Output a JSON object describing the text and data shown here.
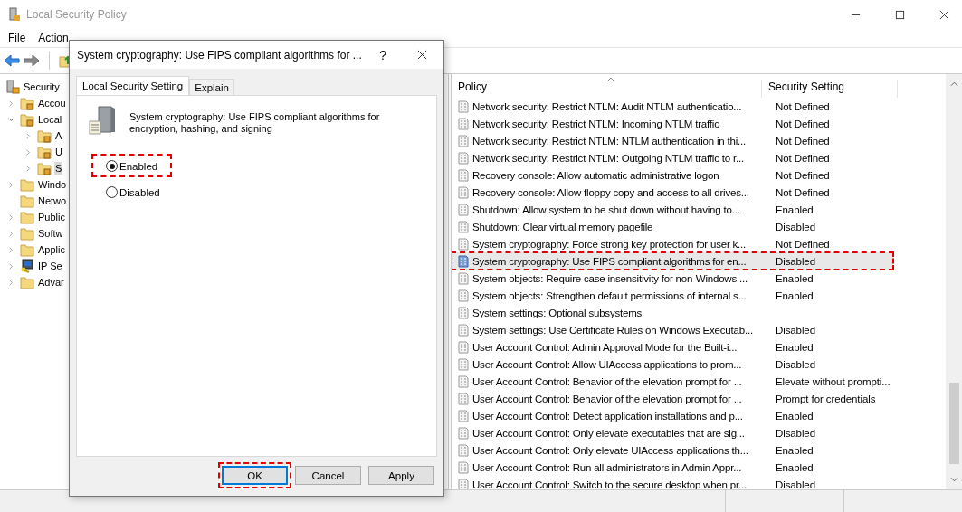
{
  "window": {
    "title": "Local Security Policy"
  },
  "menu": [
    "File",
    "Action"
  ],
  "tree": {
    "label": "Security",
    "kind": "root",
    "children": [
      {
        "label": "Accou",
        "kind": "locked_folder",
        "expanded": false,
        "selected": false
      },
      {
        "label": "Local",
        "kind": "locked_folder",
        "expanded": true,
        "selected": false,
        "children": [
          {
            "label": "A",
            "kind": "locked_folder",
            "expanded": false,
            "selected": false
          },
          {
            "label": "U",
            "kind": "locked_folder",
            "expanded": false,
            "selected": false
          },
          {
            "label": "S",
            "kind": "locked_folder",
            "expanded": false,
            "selected": true
          }
        ]
      },
      {
        "label": "Windo",
        "kind": "folder",
        "expanded": false,
        "selected": false
      },
      {
        "label": "Netwo",
        "kind": "folder",
        "selected": false
      },
      {
        "label": "Public",
        "kind": "folder",
        "expanded": false,
        "selected": false
      },
      {
        "label": "Softw",
        "kind": "folder",
        "expanded": false,
        "selected": false
      },
      {
        "label": "Applic",
        "kind": "folder",
        "expanded": false,
        "selected": false
      },
      {
        "label": "IP Se",
        "kind": "ip_security",
        "expanded": false,
        "selected": false
      },
      {
        "label": "Advar",
        "kind": "folder",
        "expanded": false,
        "selected": false
      }
    ]
  },
  "table": {
    "columns": [
      "Policy",
      "Security Setting"
    ],
    "rows": [
      {
        "policy": "Network security: Restrict NTLM: Audit NTLM authenticatio...",
        "setting": "Not Defined",
        "selected": false,
        "highlighted": false
      },
      {
        "policy": "Network security: Restrict NTLM: Incoming NTLM traffic",
        "setting": "Not Defined",
        "selected": false,
        "highlighted": false
      },
      {
        "policy": "Network security: Restrict NTLM: NTLM authentication in thi...",
        "setting": "Not Defined",
        "selected": false,
        "highlighted": false
      },
      {
        "policy": "Network security: Restrict NTLM: Outgoing NTLM traffic to r...",
        "setting": "Not Defined",
        "selected": false,
        "highlighted": false
      },
      {
        "policy": "Recovery console: Allow automatic administrative logon",
        "setting": "Not Defined",
        "selected": false,
        "highlighted": false
      },
      {
        "policy": "Recovery console: Allow floppy copy and access to all drives...",
        "setting": "Not Defined",
        "selected": false,
        "highlighted": false
      },
      {
        "policy": "Shutdown: Allow system to be shut down without having to...",
        "setting": "Enabled",
        "selected": false,
        "highlighted": false
      },
      {
        "policy": "Shutdown: Clear virtual memory pagefile",
        "setting": "Disabled",
        "selected": false,
        "highlighted": false
      },
      {
        "policy": "System cryptography: Force strong key protection for user k...",
        "setting": "Not Defined",
        "selected": false,
        "highlighted": false
      },
      {
        "policy": "System cryptography: Use FIPS compliant algorithms for en...",
        "setting": "Disabled",
        "selected": true,
        "highlighted": true
      },
      {
        "policy": "System objects: Require case insensitivity for non-Windows ...",
        "setting": "Enabled",
        "selected": false,
        "highlighted": false
      },
      {
        "policy": "System objects: Strengthen default permissions of internal s...",
        "setting": "Enabled",
        "selected": false,
        "highlighted": false
      },
      {
        "policy": "System settings: Optional subsystems",
        "selected": false,
        "highlighted": false
      },
      {
        "policy": "System settings: Use Certificate Rules on Windows Executab...",
        "setting": "Disabled",
        "selected": false,
        "highlighted": false
      },
      {
        "policy": "User Account Control: Admin Approval Mode for the Built-i...",
        "setting": "Enabled",
        "selected": false,
        "highlighted": false
      },
      {
        "policy": "User Account Control: Allow UIAccess applications to prom...",
        "setting": "Disabled",
        "selected": false,
        "highlighted": false
      },
      {
        "policy": "User Account Control: Behavior of the elevation prompt for ...",
        "setting": "Elevate without prompti...",
        "selected": false,
        "highlighted": false
      },
      {
        "policy": "User Account Control: Behavior of the elevation prompt for ...",
        "setting": "Prompt for credentials",
        "selected": false,
        "highlighted": false
      },
      {
        "policy": "User Account Control: Detect application installations and p...",
        "setting": "Enabled",
        "selected": false,
        "highlighted": false
      },
      {
        "policy": "User Account Control: Only elevate executables that are sig...",
        "setting": "Disabled",
        "selected": false,
        "highlighted": false
      },
      {
        "policy": "User Account Control: Only elevate UIAccess applications th...",
        "setting": "Enabled",
        "selected": false,
        "highlighted": false
      },
      {
        "policy": "User Account Control: Run all administrators in Admin Appr...",
        "setting": "Enabled",
        "selected": false,
        "highlighted": false
      },
      {
        "policy": "User Account Control: Switch to the secure desktop when pr...",
        "setting": "Disabled",
        "selected": false,
        "highlighted": false
      }
    ]
  },
  "dialog": {
    "title": "System cryptography: Use FIPS compliant algorithms for ...",
    "help": "?",
    "tabs": [
      {
        "label": "Local Security Setting",
        "selected": true
      },
      {
        "label": "Explain",
        "selected": false
      }
    ],
    "description": "System cryptography: Use FIPS compliant algorithms for encryption, hashing, and signing",
    "options": [
      {
        "label": "Enabled",
        "selected": true,
        "highlighted": true
      },
      {
        "label": "Disabled",
        "selected": false,
        "highlighted": false
      }
    ],
    "buttons": [
      {
        "label": "OK",
        "default": true,
        "highlighted": true
      },
      {
        "label": "Cancel",
        "default": false,
        "highlighted": false
      },
      {
        "label": "Apply",
        "default": false,
        "highlighted": false
      }
    ]
  }
}
